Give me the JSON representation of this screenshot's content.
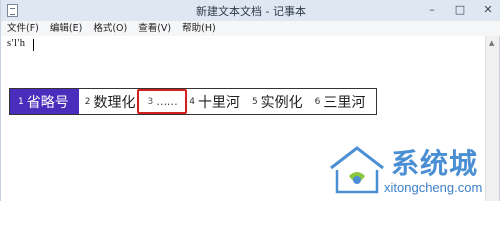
{
  "window": {
    "title": "新建文本文档 - 记事本",
    "controls": {
      "minimize": "–",
      "maximize": "□",
      "close": "✕"
    }
  },
  "menubar": {
    "items": [
      "文件(F)",
      "编辑(E)",
      "格式(O)",
      "查看(V)",
      "帮助(H)"
    ]
  },
  "editor": {
    "typed_text": "s'l'h"
  },
  "ime": {
    "candidates": [
      {
        "num": "1",
        "text": "省略号",
        "selected": true
      },
      {
        "num": "2",
        "text": "数理化"
      },
      {
        "num": "3",
        "text": "……",
        "highlighted": true
      },
      {
        "num": "4",
        "text": "十里河"
      },
      {
        "num": "5",
        "text": "实例化"
      },
      {
        "num": "6",
        "text": "三里河"
      }
    ]
  },
  "watermark": {
    "brand": "系统城",
    "url": "xitongcheng.com",
    "colors": {
      "blue": "#4a8fd4",
      "green": "#8cc63f"
    }
  },
  "colors": {
    "candidate_selected_bg": "#4a2dbd",
    "highlight_border": "#d31f1f",
    "titlebar_bg": "#dfe7f2"
  }
}
